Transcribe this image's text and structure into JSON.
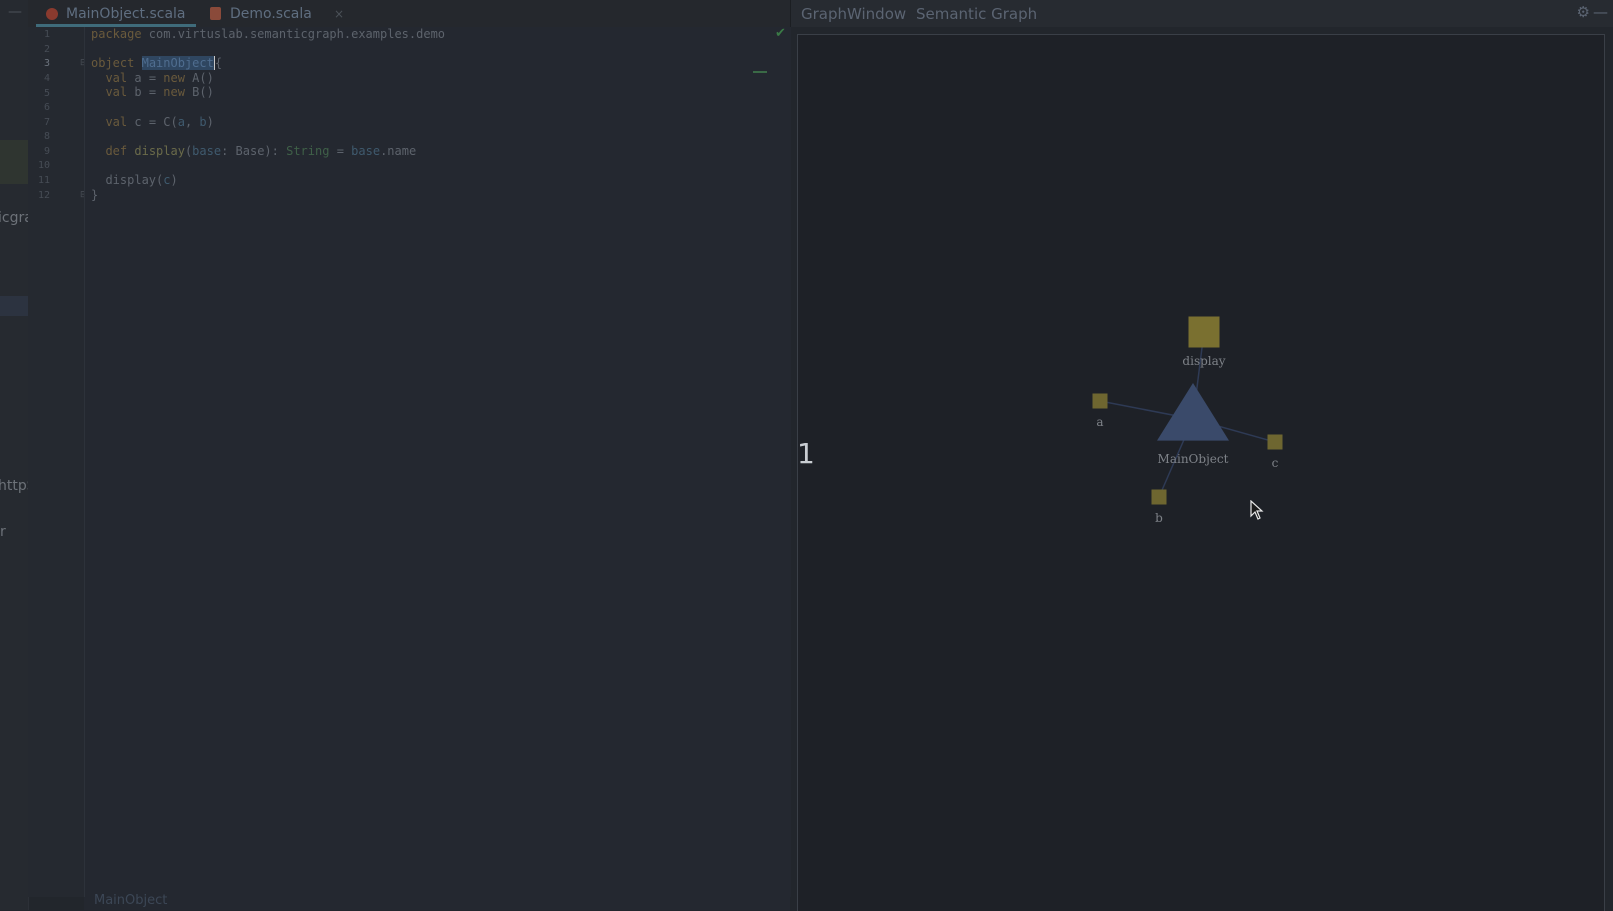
{
  "left_strip": {
    "fragments": [
      "icgra",
      "httpS",
      "r"
    ]
  },
  "editor": {
    "tabs": [
      {
        "label": "MainObject.scala",
        "active": true
      },
      {
        "label": "Demo.scala",
        "active": false
      }
    ],
    "line_numbers": [
      "1",
      "2",
      "3",
      "4",
      "5",
      "6",
      "7",
      "8",
      "9",
      "10",
      "11",
      "12"
    ],
    "current_line": "3",
    "code": {
      "l1_kw": "package",
      "l1_rest": " com.virtuslab.semanticgraph.examples.demo",
      "l3_kw": "object",
      "l3_name": "MainObject",
      "l3_brace": "{",
      "l4_kw": "val",
      "l4_mid": " a = ",
      "l4_new": "new",
      "l4_rest": " A()",
      "l5_kw": "val",
      "l5_mid": " b = ",
      "l5_new": "new",
      "l5_rest": " B()",
      "l7_kw": "val",
      "l7_mid": " c = C(",
      "l7_a": "a",
      "l7_sep": ", ",
      "l7_b": "b",
      "l7_end": ")",
      "l9_kw": "def",
      "l9_fn": " display",
      "l9_p1": "(",
      "l9_param": "base",
      "l9_p2": ": Base): ",
      "l9_type": "String",
      "l9_eq": " = ",
      "l9_ref": "base",
      "l9_end": ".name",
      "l11_fn": "display",
      "l11_p1": "(",
      "l11_arg": "c",
      "l11_p2": ")",
      "l12": "}"
    },
    "status_breadcrumb": "MainObject",
    "check_icon": "checkmark-icon"
  },
  "graph_window": {
    "title": "GraphWindow",
    "tab": "Semantic Graph",
    "zoom_index": "1",
    "gear_icon": "gear-icon",
    "minimize_icon": "minimize-icon",
    "nodes": [
      {
        "id": "MainObject",
        "label": "MainObject",
        "kind": "object",
        "color": "#3a4a6a"
      },
      {
        "id": "display",
        "label": "display",
        "kind": "method",
        "color": "#7a7030"
      },
      {
        "id": "a",
        "label": "a",
        "kind": "value",
        "color": "#6e6630"
      },
      {
        "id": "b",
        "label": "b",
        "kind": "value",
        "color": "#6e6630"
      },
      {
        "id": "c",
        "label": "c",
        "kind": "value",
        "color": "#6e6630"
      }
    ],
    "edges": [
      {
        "from": "MainObject",
        "to": "display"
      },
      {
        "from": "MainObject",
        "to": "a"
      },
      {
        "from": "MainObject",
        "to": "b"
      },
      {
        "from": "MainObject",
        "to": "c"
      }
    ]
  }
}
